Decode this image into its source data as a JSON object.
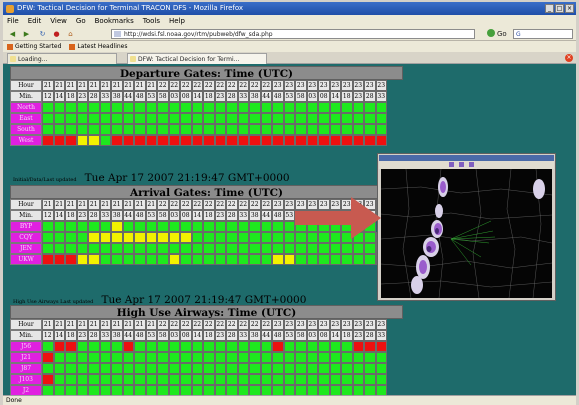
{
  "window": {
    "title": "DFW: Tactical Decision for Terminal TRACON DFS - Mozilla Firefox"
  },
  "menu": [
    "File",
    "Edit",
    "View",
    "Go",
    "Bookmarks",
    "Tools",
    "Help"
  ],
  "address": {
    "url": "http://wdsi.fsl.noaa.gov/rtm/pubweb/dfw_sda.php",
    "go_label": "Go",
    "search_value": "G"
  },
  "bookmarks": [
    "Getting Started",
    "Latest Headlines"
  ],
  "tabs": [
    "Loading...",
    "DFW: Tactical Decision for Termi..."
  ],
  "status": "Done",
  "header_labels": {
    "hour": "Hour",
    "min": "Min."
  },
  "hours": [
    "21",
    "21",
    "21",
    "21",
    "21",
    "21",
    "21",
    "21",
    "21",
    "21",
    "22",
    "22",
    "22",
    "22",
    "22",
    "22",
    "22",
    "22",
    "22",
    "22",
    "23",
    "23",
    "23",
    "23",
    "23",
    "23",
    "23",
    "23",
    "23",
    "23"
  ],
  "minutes": [
    "12",
    "14",
    "18",
    "23",
    "28",
    "33",
    "38",
    "44",
    "48",
    "53",
    "58",
    "03",
    "08",
    "14",
    "18",
    "23",
    "28",
    "33",
    "38",
    "44",
    "48",
    "53",
    "58",
    "03",
    "08",
    "14",
    "18",
    "23",
    "28",
    "33"
  ],
  "departure": {
    "title": "Departure Gates: Time (UTC)",
    "rows": [
      {
        "label": "North",
        "cells": "gggggggggggggggggggggggggggggg"
      },
      {
        "label": "East",
        "cells": "gggggggggggggggggggggggggggggg"
      },
      {
        "label": "South",
        "cells": "gggggggggggggggggggggggggggggg"
      },
      {
        "label": "West",
        "cells": "rrryygrrrrrrrrrrrrrrrrrrrrrrrr"
      }
    ]
  },
  "departure_updated": {
    "label": "Initial/Data/Last updated",
    "time": "Tue Apr 17 2007 21:19:47 GMT+0000"
  },
  "arrival": {
    "title": "Arrival Gates: Time (UTC)",
    "rows": [
      {
        "label": "BYP",
        "cells": "ggggggygggggggggggggggggggggg"
      },
      {
        "label": "CQY",
        "cells": "ggggyyyyyyyyyggggggggggggggggg"
      },
      {
        "label": "JEN",
        "cells": "gggggggggggggggggggggggggggggg"
      },
      {
        "label": "UKW",
        "cells": "rrryyggggggyggggggggyygggggggg"
      }
    ]
  },
  "arrival_updated": {
    "label": "High Use Airways Last updated",
    "time": "Tue Apr 17 2007 21:19:47 GMT+0000"
  },
  "airways": {
    "title": "High Use Airways: Time (UTC)",
    "rows": [
      {
        "label": "J56",
        "cells": "grrggggrggggggggggggrggggggrrr"
      },
      {
        "label": "J21",
        "cells": "rgggggggggggggggggggggggggggggg"
      },
      {
        "label": "J87",
        "cells": "gggggggggggggggggggggggggggggg"
      },
      {
        "label": "J103",
        "cells": "rgggggggggggggggggggggggggggggg"
      },
      {
        "label": "J2",
        "cells": "gggggggggggggggggggggggggggggg"
      }
    ]
  },
  "colors": {
    "green": "#1ee81e",
    "yellow": "#f2f200",
    "red": "#ee1010",
    "label_magenta": "#e020e0",
    "page_bg": "#1e6b6b",
    "arrow": "#c85a50"
  },
  "radar_popup": {
    "icon": "weather-radar-image"
  }
}
